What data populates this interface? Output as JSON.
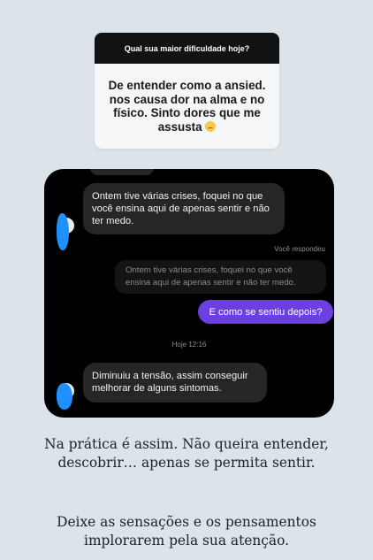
{
  "question_sticker": {
    "prompt": "Qual sua maior dificuldade hoje?",
    "answer_lines": [
      "De entender como  a ansied.",
      "nos causa dor na alma e no",
      "físico. Sinto dores que me",
      "assusta"
    ],
    "emoji": "worried-face-emoji"
  },
  "chat": {
    "incoming_message_1": "Ontem tive várias crises, foquei no que você ensina aqui de apenas sentir e não ter medo.",
    "replied_label": "Você respondeu",
    "quoted_message": "Ontem tive várias crises, foquei no que você ensina aqui de apenas sentir e não ter medo.",
    "outgoing_message": "E como se sentiu depois?",
    "timestamp": "Hoje 12:16",
    "incoming_message_2": "Diminuiu a tensão, assim conseguir melhorar de alguns sintomas."
  },
  "caption": {
    "paragraph_1": "Na prática é assim. Não queira entender, descobrir… apenas se permita sentir.",
    "paragraph_2": "Deixe as sensações e os pensamentos implorarem pela sua atenção."
  },
  "colors": {
    "page_background": "#dce3e9",
    "outgoing_bubble": "#6b3fe0",
    "incoming_bubble": "#262626",
    "avatar_censor": "#1e90ff"
  }
}
